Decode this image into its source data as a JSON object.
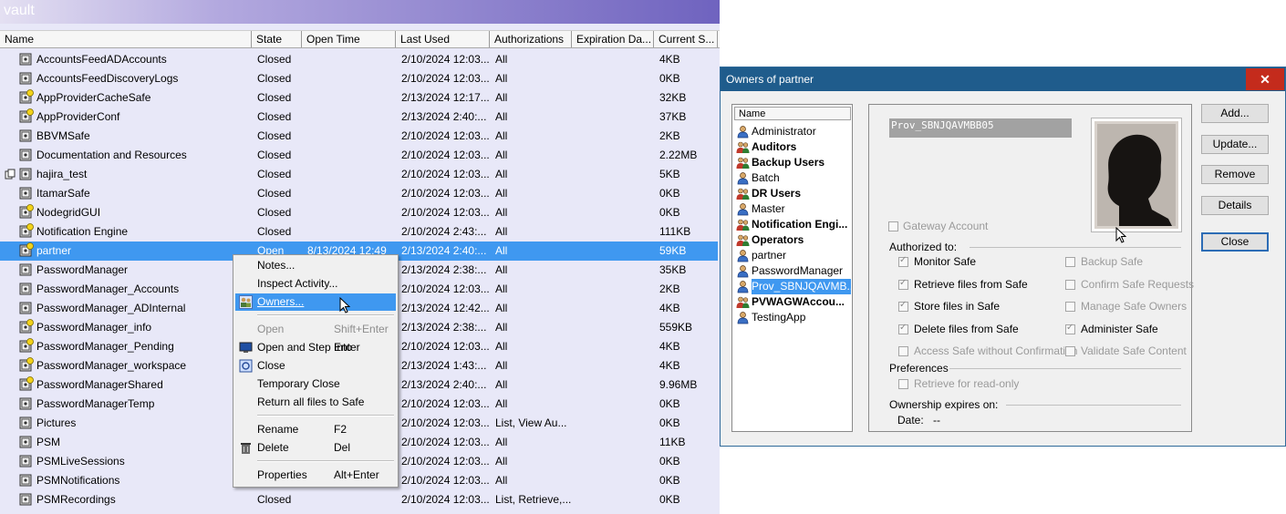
{
  "vault": {
    "title": "vault",
    "columns": [
      "Name",
      "State",
      "Open Time",
      "Last Used",
      "Authorizations",
      "Expiration Da...",
      "Current S..."
    ],
    "rows": [
      {
        "name": "AccountsFeedADAccounts",
        "state": "Closed",
        "open_time": "",
        "last_used": "2/10/2024 12:03...",
        "auth": "All",
        "size": "4KB"
      },
      {
        "name": "AccountsFeedDiscoveryLogs",
        "state": "Closed",
        "open_time": "",
        "last_used": "2/10/2024 12:03...",
        "auth": "All",
        "size": "0KB"
      },
      {
        "name": "AppProviderCacheSafe",
        "state": "Closed",
        "open_time": "",
        "last_used": "2/13/2024 12:17...",
        "auth": "All",
        "size": "32KB"
      },
      {
        "name": "AppProviderConf",
        "state": "Closed",
        "open_time": "",
        "last_used": "2/13/2024 2:40:...",
        "auth": "All",
        "size": "37KB"
      },
      {
        "name": "BBVMSafe",
        "state": "Closed",
        "open_time": "",
        "last_used": "2/10/2024 12:03...",
        "auth": "All",
        "size": "2KB"
      },
      {
        "name": "Documentation and Resources",
        "state": "Closed",
        "open_time": "",
        "last_used": "2/10/2024 12:03...",
        "auth": "All",
        "size": "2.22MB"
      },
      {
        "name": "hajira_test",
        "state": "Closed",
        "open_time": "",
        "last_used": "2/10/2024 12:03...",
        "auth": "All",
        "size": "5KB"
      },
      {
        "name": "ItamarSafe",
        "state": "Closed",
        "open_time": "",
        "last_used": "2/10/2024 12:03...",
        "auth": "All",
        "size": "0KB"
      },
      {
        "name": "NodegridGUI",
        "state": "Closed",
        "open_time": "",
        "last_used": "2/10/2024 12:03...",
        "auth": "All",
        "size": "0KB"
      },
      {
        "name": "Notification Engine",
        "state": "Closed",
        "open_time": "",
        "last_used": "2/10/2024 2:43:...",
        "auth": "All",
        "size": "111KB"
      },
      {
        "name": "partner",
        "state": "Open",
        "open_time": "8/13/2024 12:49",
        "last_used": "2/13/2024 2:40:...",
        "auth": "All",
        "size": "59KB"
      },
      {
        "name": "PasswordManager",
        "state": "",
        "open_time": "",
        "last_used": "2/13/2024 2:38:...",
        "auth": "All",
        "size": "35KB"
      },
      {
        "name": "PasswordManager_Accounts",
        "state": "",
        "open_time": "",
        "last_used": "2/10/2024 12:03...",
        "auth": "All",
        "size": "2KB"
      },
      {
        "name": "PasswordManager_ADInternal",
        "state": "",
        "open_time": "",
        "last_used": "2/13/2024 12:42...",
        "auth": "All",
        "size": "4KB"
      },
      {
        "name": "PasswordManager_info",
        "state": "",
        "open_time": "",
        "last_used": "2/13/2024 2:38:...",
        "auth": "All",
        "size": "559KB"
      },
      {
        "name": "PasswordManager_Pending",
        "state": "",
        "open_time": "",
        "last_used": "2/10/2024 12:03...",
        "auth": "All",
        "size": "4KB"
      },
      {
        "name": "PasswordManager_workspace",
        "state": "",
        "open_time": "",
        "last_used": "2/13/2024 1:43:...",
        "auth": "All",
        "size": "4KB"
      },
      {
        "name": "PasswordManagerShared",
        "state": "",
        "open_time": "",
        "last_used": "2/13/2024 2:40:...",
        "auth": "All",
        "size": "9.96MB"
      },
      {
        "name": "PasswordManagerTemp",
        "state": "",
        "open_time": "",
        "last_used": "2/10/2024 12:03...",
        "auth": "All",
        "size": "0KB"
      },
      {
        "name": "Pictures",
        "state": "",
        "open_time": "",
        "last_used": "2/10/2024 12:03...",
        "auth": "List, View Au...",
        "size": "0KB"
      },
      {
        "name": "PSM",
        "state": "",
        "open_time": "",
        "last_used": "2/10/2024 12:03...",
        "auth": "All",
        "size": "11KB"
      },
      {
        "name": "PSMLiveSessions",
        "state": "",
        "open_time": "",
        "last_used": "2/10/2024 12:03...",
        "auth": "All",
        "size": "0KB"
      },
      {
        "name": "PSMNotifications",
        "state": "",
        "open_time": "",
        "last_used": "2/10/2024 12:03...",
        "auth": "All",
        "size": "0KB"
      },
      {
        "name": "PSMRecordings",
        "state": "Closed",
        "open_time": "",
        "last_used": "2/10/2024 12:03...",
        "auth": "List, Retrieve,...",
        "size": "0KB"
      }
    ]
  },
  "context_menu": {
    "items": [
      {
        "label": "Notes...",
        "shortcut": ""
      },
      {
        "label": "Inspect Activity...",
        "shortcut": ""
      },
      {
        "label": "Owners...",
        "shortcut": ""
      },
      {
        "label": "Open",
        "shortcut": "Shift+Enter"
      },
      {
        "label": "Open and Step Into",
        "shortcut": "Enter"
      },
      {
        "label": "Close",
        "shortcut": ""
      },
      {
        "label": "Temporary Close",
        "shortcut": ""
      },
      {
        "label": "Return all files to Safe",
        "shortcut": ""
      },
      {
        "label": "Rename",
        "shortcut": "F2"
      },
      {
        "label": "Delete",
        "shortcut": "Del"
      },
      {
        "label": "Properties",
        "shortcut": "Alt+Enter"
      }
    ]
  },
  "owners_dialog": {
    "title": "Owners of partner",
    "close_glyph": "✕",
    "list_header": "Name",
    "owners": [
      {
        "name": "Administrator",
        "type": "user"
      },
      {
        "name": "Auditors",
        "type": "group"
      },
      {
        "name": "Backup Users",
        "type": "group"
      },
      {
        "name": "Batch",
        "type": "user"
      },
      {
        "name": "DR Users",
        "type": "group"
      },
      {
        "name": "Master",
        "type": "user"
      },
      {
        "name": "Notification Engi...",
        "type": "group"
      },
      {
        "name": "Operators",
        "type": "group"
      },
      {
        "name": "partner",
        "type": "user"
      },
      {
        "name": "PasswordManager",
        "type": "user"
      },
      {
        "name": "Prov_SBNJQAVMB...",
        "type": "user"
      },
      {
        "name": "PVWAGWAccou...",
        "type": "group"
      },
      {
        "name": "TestingApp",
        "type": "user"
      }
    ],
    "selected_owner": "Prov_SBNJQAVMBB05",
    "gateway_account": "Gateway Account",
    "authorized_to_label": "Authorized to:",
    "permissions": [
      {
        "label": "Monitor Safe",
        "checked": true
      },
      {
        "label": "Backup Safe",
        "checked": false
      },
      {
        "label": "Retrieve files from Safe",
        "checked": true
      },
      {
        "label": "Confirm Safe Requests",
        "checked": false
      },
      {
        "label": "Store files in Safe",
        "checked": true
      },
      {
        "label": "Manage Safe Owners",
        "checked": false
      },
      {
        "label": "Delete files from Safe",
        "checked": true
      },
      {
        "label": "Administer Safe",
        "checked": true
      },
      {
        "label": "Access Safe without Confirmation",
        "checked": false
      },
      {
        "label": "Validate Safe Content",
        "checked": false
      }
    ],
    "preferences_label": "Preferences",
    "retrieve_read_only": "Retrieve for read-only",
    "ownership_expires_label": "Ownership expires on:",
    "date_label": "Date:",
    "date_value": "--",
    "buttons": {
      "add": "Add...",
      "update": "Update...",
      "remove": "Remove",
      "details": "Details",
      "close": "Close"
    }
  }
}
